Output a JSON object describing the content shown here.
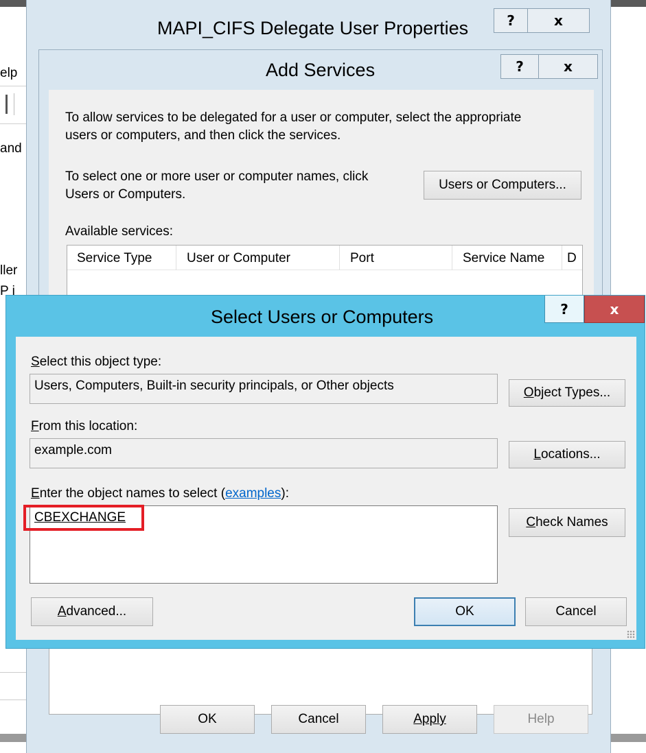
{
  "background_window": {
    "menu_fragment": "elp",
    "tree_fragment_1": "and",
    "tree_fragment_2": "ller",
    "tree_fragment_3": "P i"
  },
  "mapi_dialog": {
    "title": "MAPI_CIFS Delegate User Properties",
    "help_glyph": "?",
    "close_glyph": "x",
    "buttons": {
      "ok": "OK",
      "cancel": "Cancel",
      "apply": "Apply",
      "help": "Help"
    }
  },
  "add_services": {
    "title": "Add Services",
    "help_glyph": "?",
    "close_glyph": "x",
    "intro_line1": "To allow services to be delegated for a user or computer, select the appropriate",
    "intro_line2": "users or computers, and then click the services.",
    "select_line1": "To select one or more user or computer names, click",
    "select_line2": "Users or Computers.",
    "users_button": "Users or Computers...",
    "available_label": "Available services:",
    "columns": [
      "Service Type",
      "User or Computer",
      "Port",
      "Service Name",
      "D"
    ]
  },
  "select_users": {
    "title": "Select Users or Computers",
    "help_glyph": "?",
    "close_glyph": "x",
    "object_type_label": {
      "access": "S",
      "rest": "elect this object type:"
    },
    "object_type_value": "Users, Computers, Built-in security principals, or Other objects",
    "object_types_button": {
      "access": "O",
      "rest": "bject Types..."
    },
    "location_label": {
      "access": "F",
      "rest": "rom this location:"
    },
    "location_value": "example.com",
    "locations_button": {
      "access": "L",
      "rest": "ocations..."
    },
    "names_label": {
      "access": "E",
      "rest": "nter the object names to select (",
      "link": "examples",
      "suffix": "):"
    },
    "names_value": "CBEXCHANGE",
    "check_names_button": {
      "access": "C",
      "rest": "heck Names"
    },
    "advanced_button": {
      "access": "A",
      "rest": "dvanced..."
    },
    "ok_button": "OK",
    "cancel_button": "Cancel"
  },
  "colors": {
    "dialog_frame": "#d9e6f0",
    "active_frame": "#5ac3e6",
    "close_red": "#c75050",
    "highlight_red": "#e41e26",
    "link_blue": "#0066cc"
  }
}
